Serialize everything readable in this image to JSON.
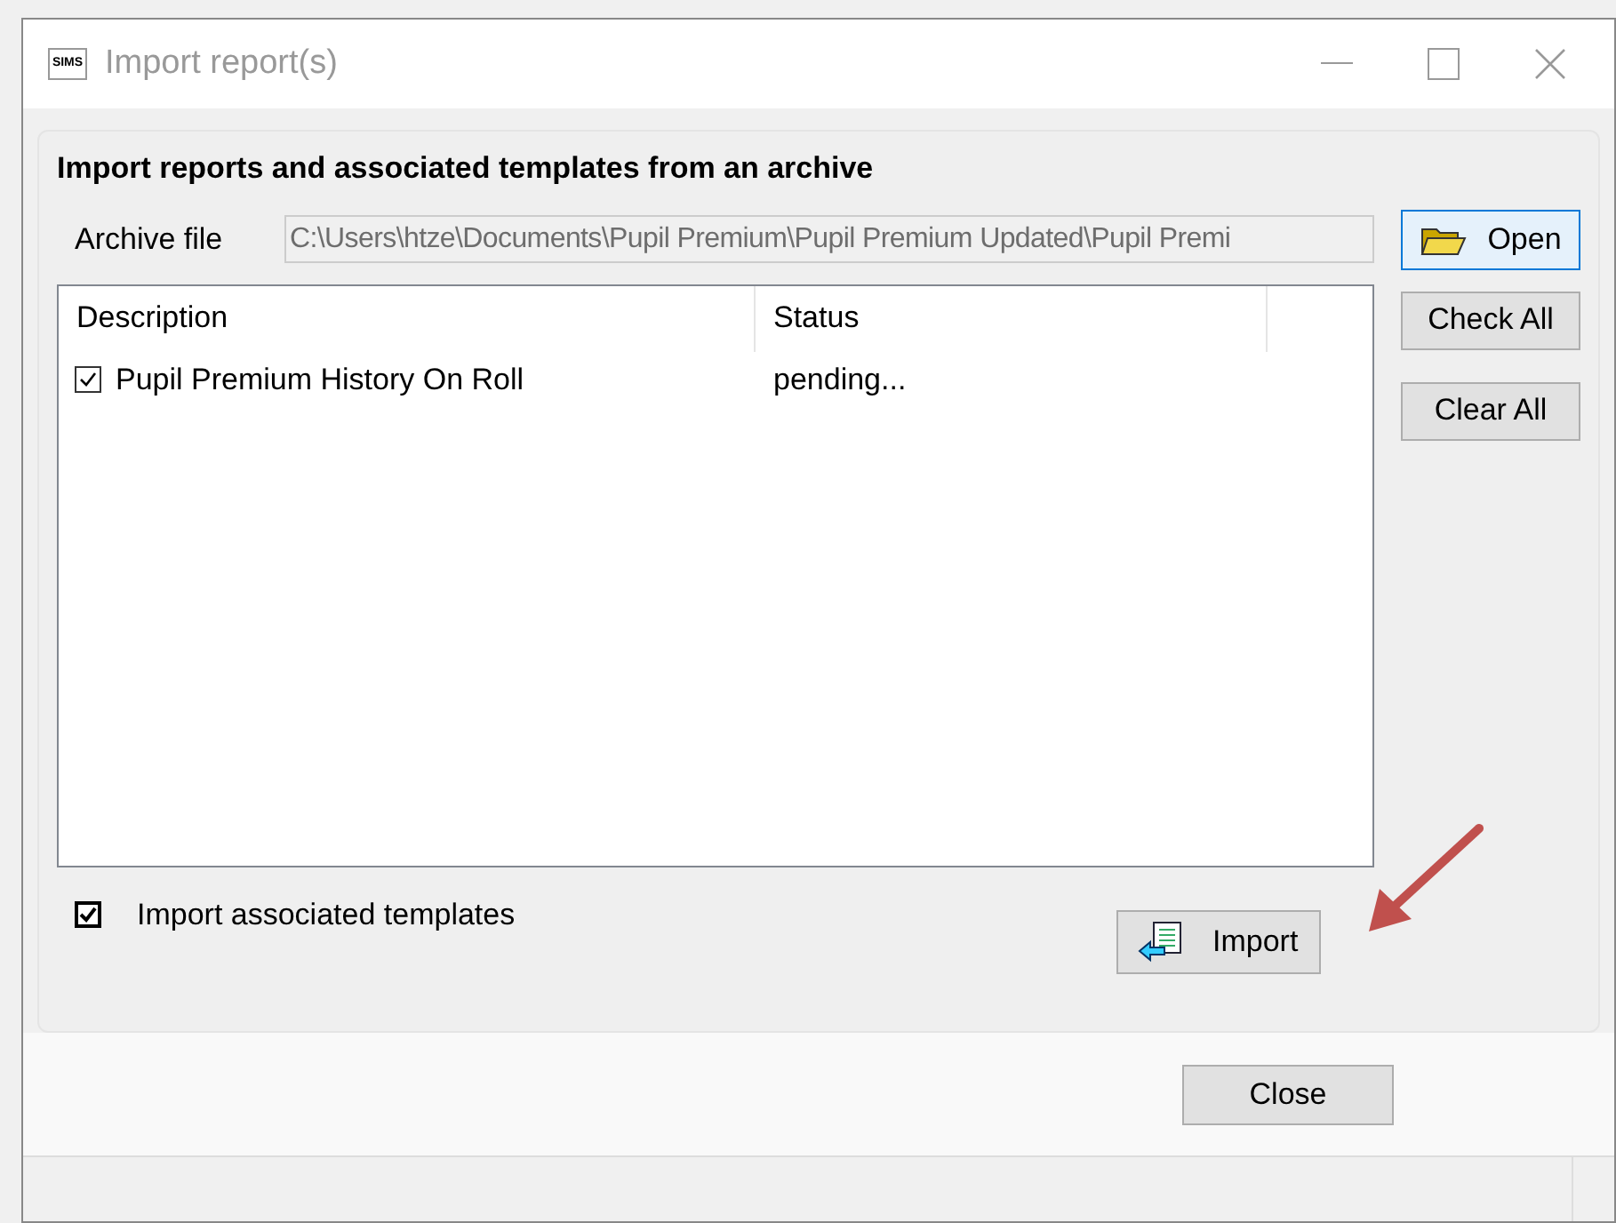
{
  "window": {
    "app_badge": "SIMS",
    "title": "Import report(s)"
  },
  "panel": {
    "heading": "Import reports and associated templates from an archive",
    "archive_label": "Archive file",
    "archive_value": "C:\\Users\\htze\\Documents\\Pupil Premium\\Pupil Premium Updated\\Pupil Premi",
    "open_button": "Open"
  },
  "table": {
    "columns": [
      "Description",
      "Status"
    ],
    "rows": [
      {
        "description": "Pupil Premium History On Roll",
        "status": "pending...",
        "checked": true
      }
    ]
  },
  "side_buttons": [
    "Check All",
    "Clear All"
  ],
  "import_templates": {
    "label": "Import associated templates",
    "checked": true
  },
  "import_button": "Import",
  "close_button": "Close"
}
